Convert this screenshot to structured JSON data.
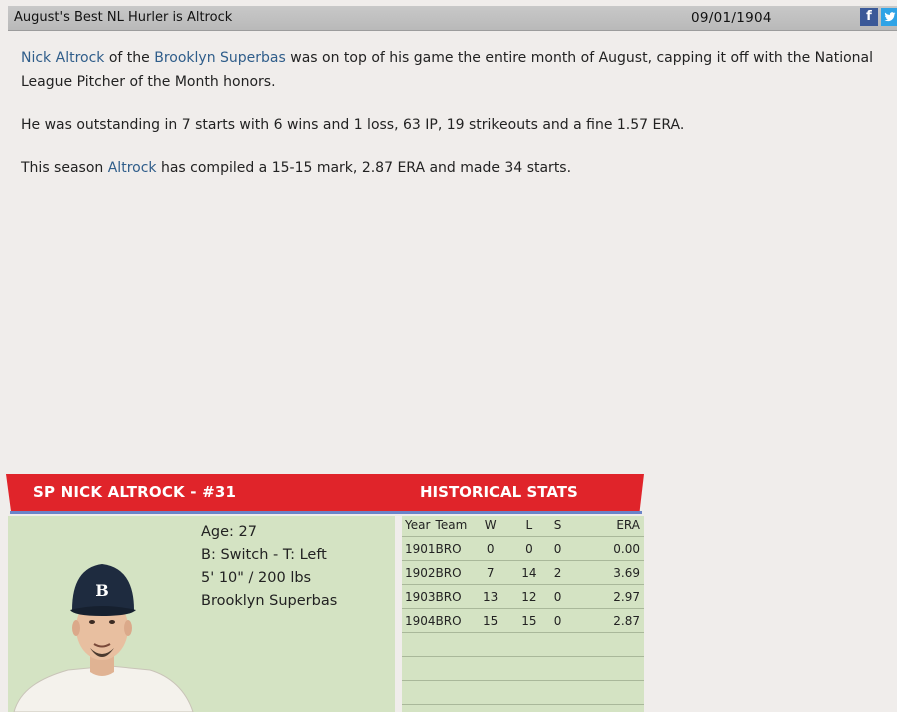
{
  "article": {
    "headline": "August's Best NL Hurler is Altrock",
    "date": "09/01/1904",
    "share": {
      "facebook": "f",
      "twitter": "t"
    },
    "p1": {
      "player_link": "Nick Altrock",
      "text1": " of the ",
      "team_link": "Brooklyn Superbas",
      "text2": " was on top of his game the entire month of August, capping it off with the National League Pitcher of the Month honors."
    },
    "p2": "He was outstanding in 7 starts with 6 wins and 1 loss, 63 IP, 19 strikeouts and a fine 1.57 ERA.",
    "p3": {
      "text1": "This season ",
      "player_link": "Altrock",
      "text2": " has compiled a 15-15 mark, 2.87 ERA and made 34 starts."
    }
  },
  "card": {
    "title": "SP NICK ALTROCK - #31",
    "hist_title": "HISTORICAL STATS",
    "bio": {
      "age": "Age: 27",
      "bats_throws": "B: Switch - T: Left",
      "size": "5' 10\" / 200 lbs",
      "team": "Brooklyn Superbas"
    },
    "cap_letter": "B",
    "stats": {
      "headers": [
        "Year",
        "Team",
        "W",
        "L",
        "S",
        "ERA"
      ],
      "rows": [
        [
          "1901",
          "BRO",
          "0",
          "0",
          "0",
          "0.00"
        ],
        [
          "1902",
          "BRO",
          "7",
          "14",
          "2",
          "3.69"
        ],
        [
          "1903",
          "BRO",
          "13",
          "12",
          "0",
          "2.97"
        ],
        [
          "1904",
          "BRO",
          "15",
          "15",
          "0",
          "2.87"
        ]
      ]
    }
  },
  "colors": {
    "header_red": "#e0242a",
    "panel_green": "#d4e3c3",
    "link_blue": "#2f5d8a",
    "facebook_blue": "#3b5998",
    "twitter_blue": "#2fa3e6"
  },
  "icons": [
    "facebook-icon",
    "twitter-icon"
  ]
}
